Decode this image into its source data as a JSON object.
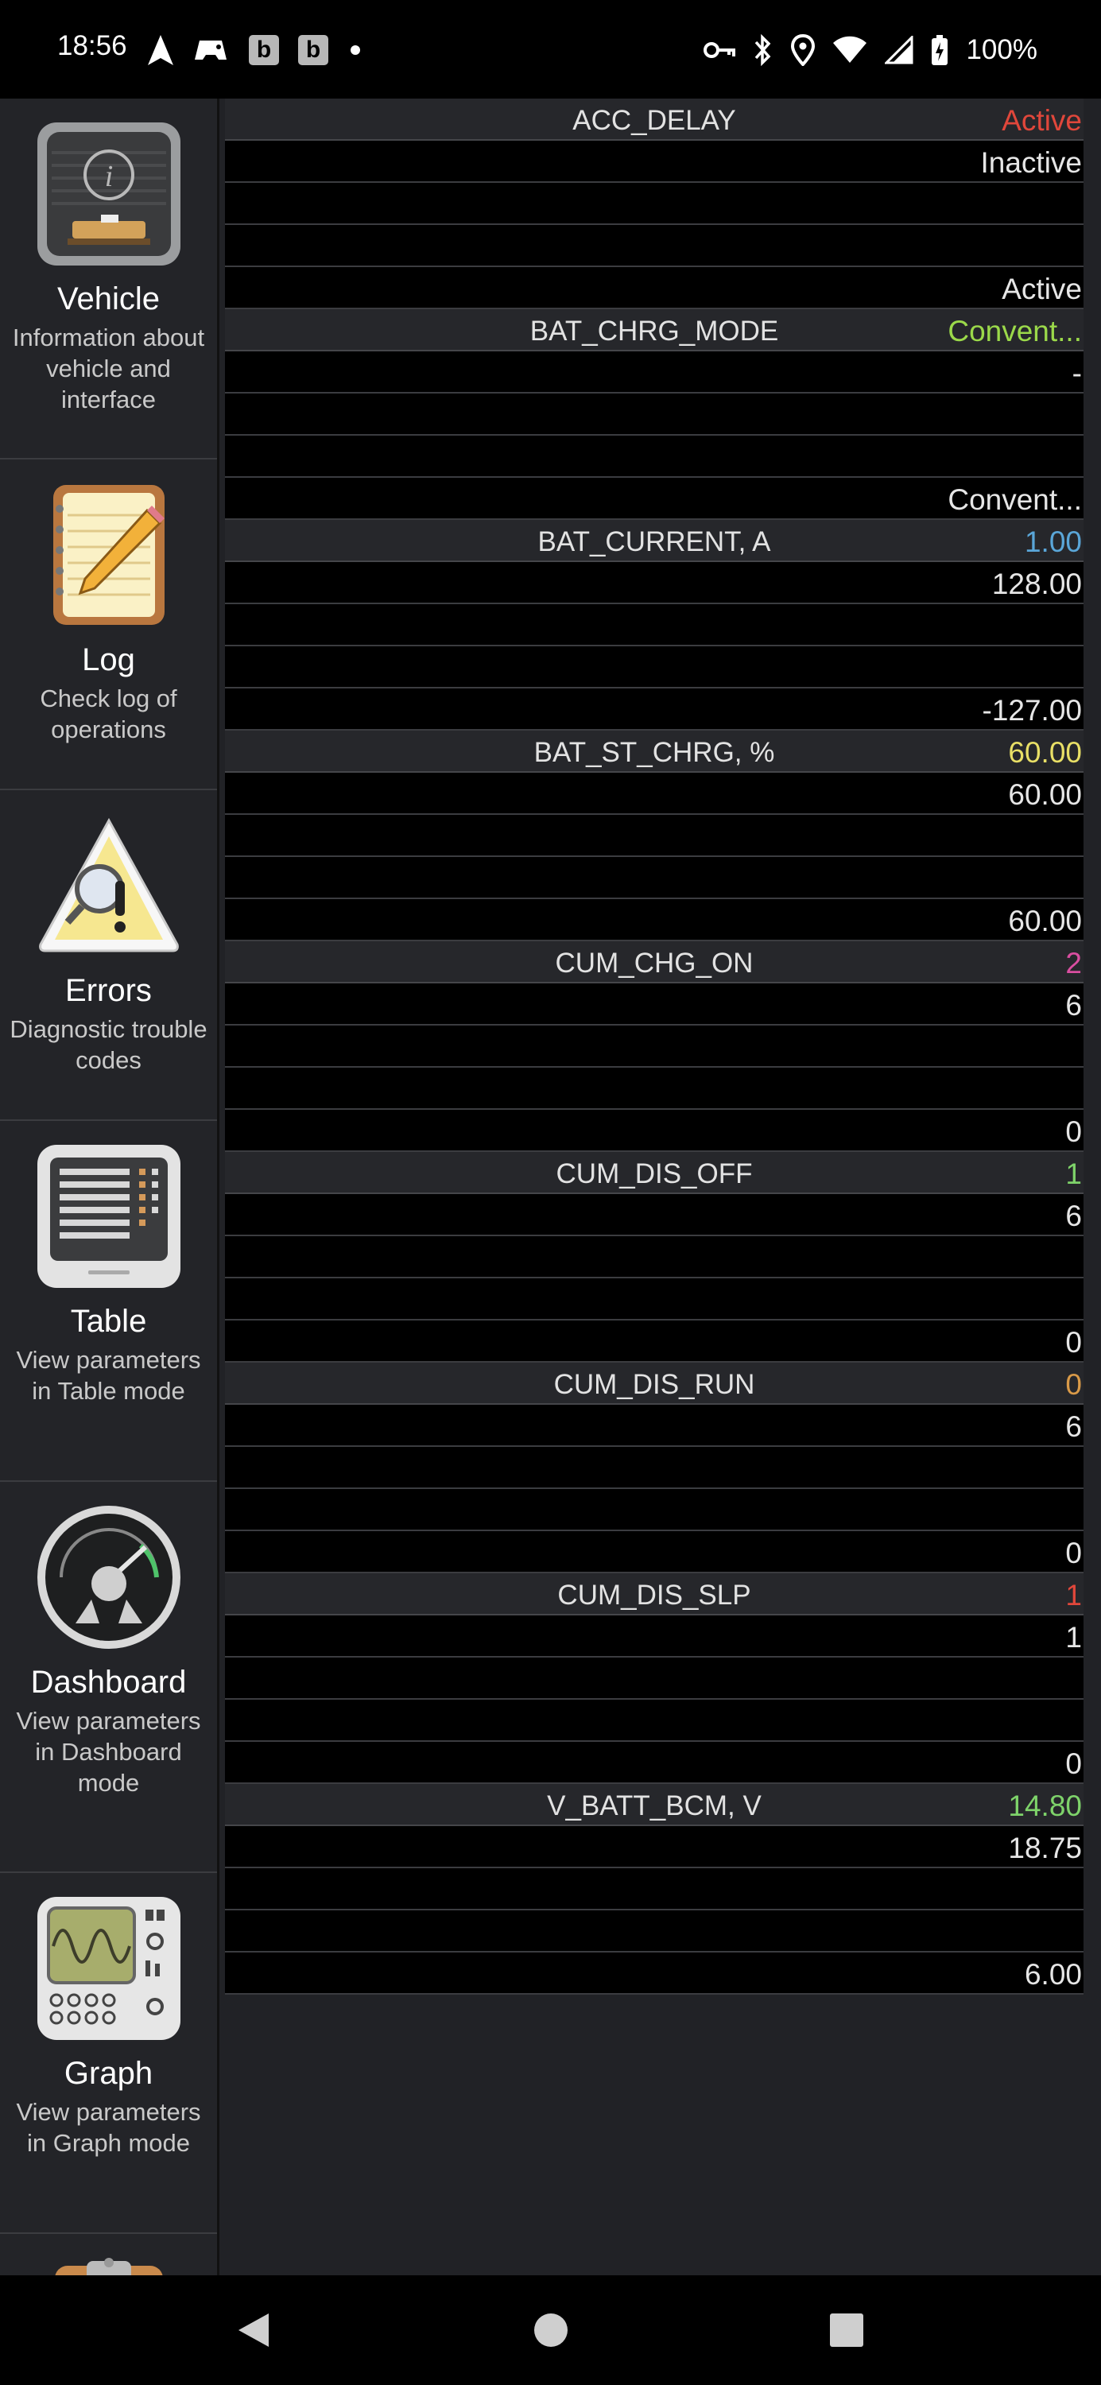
{
  "status_bar": {
    "time": "18:56",
    "box_icon_1": "b",
    "box_icon_2": "b",
    "battery_percent": "100%"
  },
  "sidebar": {
    "items": [
      {
        "label": "Vehicle",
        "desc": "Information about vehicle and interface",
        "icon": "info-panel-icon"
      },
      {
        "label": "Log",
        "desc": "Check log of operations",
        "icon": "notepad-pencil-icon"
      },
      {
        "label": "Errors",
        "desc": "Diagnostic trouble codes",
        "icon": "warning-magnifier-icon"
      },
      {
        "label": "Table",
        "desc": "View parameters in Table mode",
        "icon": "table-screen-icon"
      },
      {
        "label": "Dashboard",
        "desc": "View parameters in Dashboard mode",
        "icon": "gauge-icon"
      },
      {
        "label": "Graph",
        "desc": "View parameters in Graph mode",
        "icon": "oscilloscope-icon"
      },
      {
        "label": "",
        "desc": "",
        "icon": "clipboard-check-icon"
      }
    ]
  },
  "params": [
    {
      "name": "ACC_DELAY",
      "value": "Active",
      "color": "#e0473b",
      "rows": [
        "Inactive",
        "",
        "",
        "Active"
      ]
    },
    {
      "name": "BAT_CHRG_MODE",
      "value": "Convent...",
      "color": "#9bd94a",
      "rows": [
        "-",
        "",
        "",
        "Convent..."
      ]
    },
    {
      "name": "BAT_CURRENT, A",
      "value": "1.00",
      "color": "#5aa6d8",
      "rows": [
        "128.00",
        "",
        "",
        "-127.00"
      ]
    },
    {
      "name": "BAT_ST_CHRG, %",
      "value": "60.00",
      "color": "#e8df66",
      "rows": [
        "60.00",
        "",
        "",
        "60.00"
      ]
    },
    {
      "name": "CUM_CHG_ON",
      "value": "2",
      "color": "#d94ea0",
      "rows": [
        "6",
        "",
        "",
        "0"
      ]
    },
    {
      "name": "CUM_DIS_OFF",
      "value": "1",
      "color": "#7ed36a",
      "rows": [
        "6",
        "",
        "",
        "0"
      ]
    },
    {
      "name": "CUM_DIS_RUN",
      "value": "0",
      "color": "#d99a48",
      "rows": [
        "6",
        "",
        "",
        "0"
      ]
    },
    {
      "name": "CUM_DIS_SLP",
      "value": "1",
      "color": "#e0473b",
      "rows": [
        "1",
        "",
        "",
        "0"
      ]
    },
    {
      "name": "V_BATT_BCM, V",
      "value": "14.80",
      "color": "#7ed36a",
      "rows": [
        "18.75",
        "",
        "",
        "6.00"
      ]
    }
  ]
}
